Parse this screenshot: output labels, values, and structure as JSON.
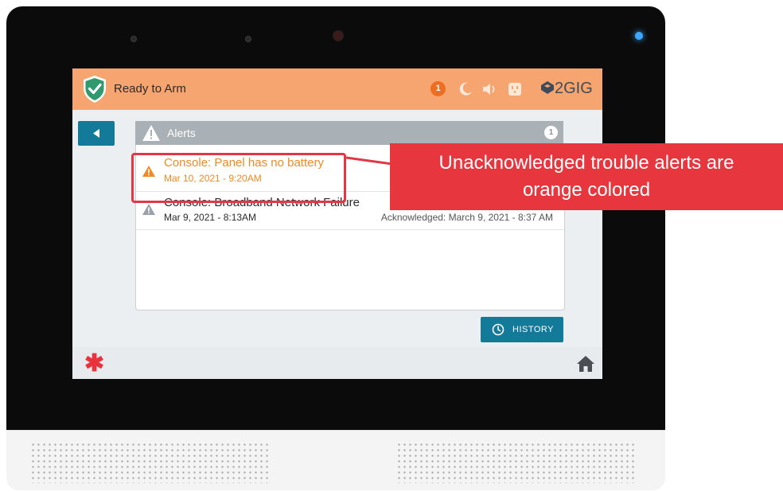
{
  "status": {
    "label": "Ready to Arm"
  },
  "topbar": {
    "notification_count": "1",
    "icons": [
      "moon-icon",
      "speaker-icon",
      "outlet-icon"
    ],
    "brand": "2GIG"
  },
  "alerts": {
    "title": "Alerts",
    "count": "1",
    "items": [
      {
        "title": "Console: Panel has no battery",
        "date": "Mar 10, 2021 - 9:20AM",
        "ack": "",
        "color": "#f08a24",
        "state": "unacknowledged"
      },
      {
        "title": "Console: Broadband Network Failure",
        "date": "Mar 9, 2021 - 8:13AM",
        "ack": "Acknowledged: March 9, 2021 - 8:37 AM",
        "color": "#2b2b2b",
        "state": "acknowledged"
      }
    ]
  },
  "history_button": {
    "label": "HISTORY"
  },
  "callout": {
    "line1": "Unacknowledged trouble alerts are",
    "line2": "orange colored"
  },
  "colors": {
    "topbar": "#f6a570",
    "accent": "#147a9a",
    "highlight": "#e03845",
    "callout": "#e8363f",
    "unacknowledged": "#f08a24"
  }
}
